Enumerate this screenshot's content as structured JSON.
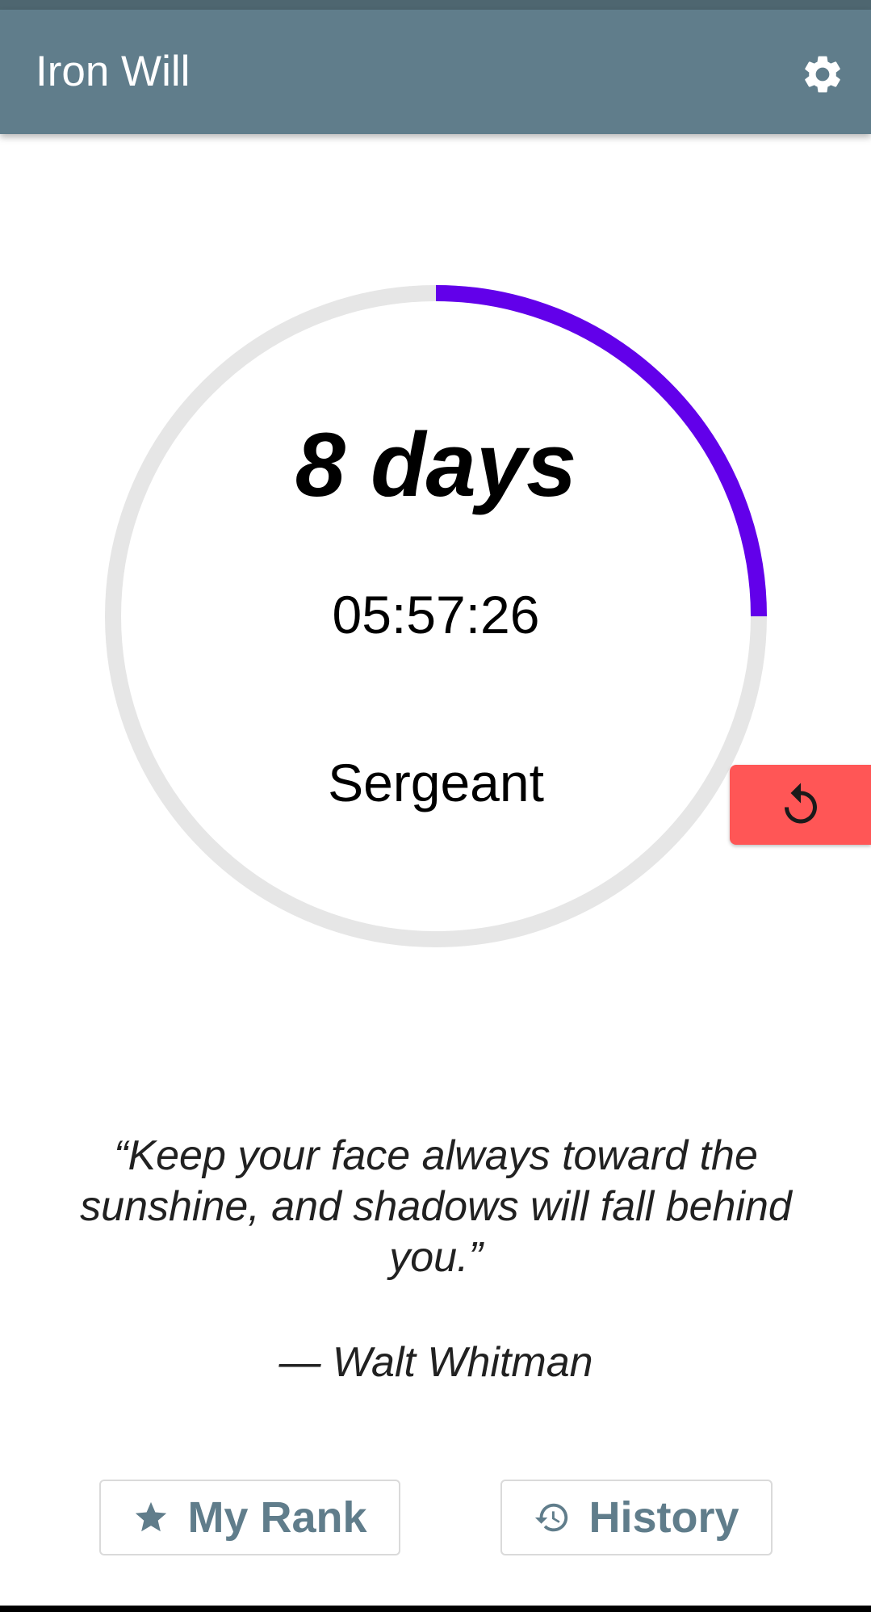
{
  "app_bar": {
    "title": "Iron Will",
    "settings_icon": "gear-icon",
    "color": "#607d8b"
  },
  "streak": {
    "days_label": "8 days",
    "timer": "05:57:26",
    "rank": "Sergeant",
    "progress_fraction": 0.25,
    "progress_color": "#6200ea",
    "track_color": "#e6e6e6"
  },
  "reset_button": {
    "icon": "reset-icon",
    "color": "#ff5656"
  },
  "quote": {
    "text": "“Keep your face always toward the sunshine, and shadows will fall behind you.”",
    "author": "— Walt Whitman"
  },
  "buttons": {
    "my_rank": {
      "label": "My Rank",
      "icon": "star-icon"
    },
    "history": {
      "label": "History",
      "icon": "history-icon"
    }
  }
}
